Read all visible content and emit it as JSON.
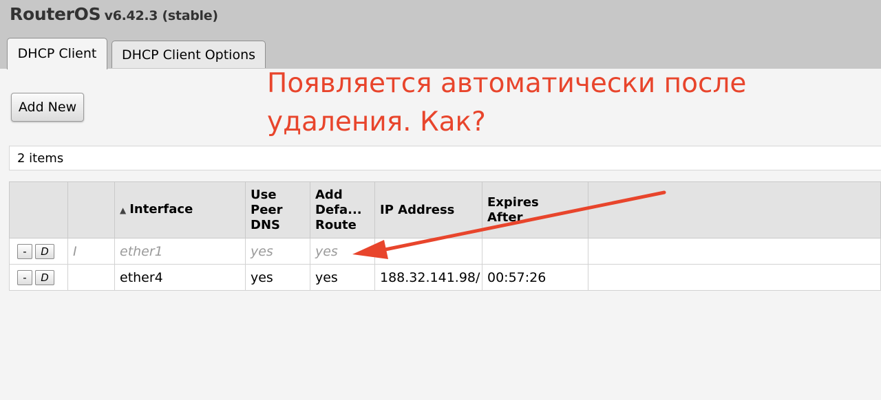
{
  "app": {
    "brand": "RouterOS",
    "version": "v6.42.3 (stable)"
  },
  "tabs": [
    {
      "label": "DHCP Client",
      "active": true
    },
    {
      "label": "DHCP Client Options",
      "active": false
    }
  ],
  "toolbar": {
    "add_new_label": "Add New"
  },
  "annotation": {
    "line1": "Появляется автоматически после",
    "line2": "удаления. Как?",
    "color": "#e8452c"
  },
  "list": {
    "count_text": "2 items",
    "sort_indicator": "▲",
    "columns": {
      "interface": "Interface",
      "use_peer_dns": [
        "Use",
        "Peer",
        "DNS"
      ],
      "add_default_route": [
        "Add",
        "Defa...",
        "Route"
      ],
      "ip_address": "IP Address",
      "expires_after": [
        "Expires",
        "After"
      ]
    },
    "rows": [
      {
        "remove_label": "-",
        "disable_label": "D",
        "flag": "I",
        "interface": "ether1",
        "use_peer_dns": "yes",
        "add_default_route": "yes",
        "ip_address": "",
        "expires_after": ""
      },
      {
        "remove_label": "-",
        "disable_label": "D",
        "flag": "",
        "interface": "ether4",
        "use_peer_dns": "yes",
        "add_default_route": "yes",
        "ip_address": "188.32.141.98/",
        "expires_after": "00:57:26"
      }
    ]
  }
}
